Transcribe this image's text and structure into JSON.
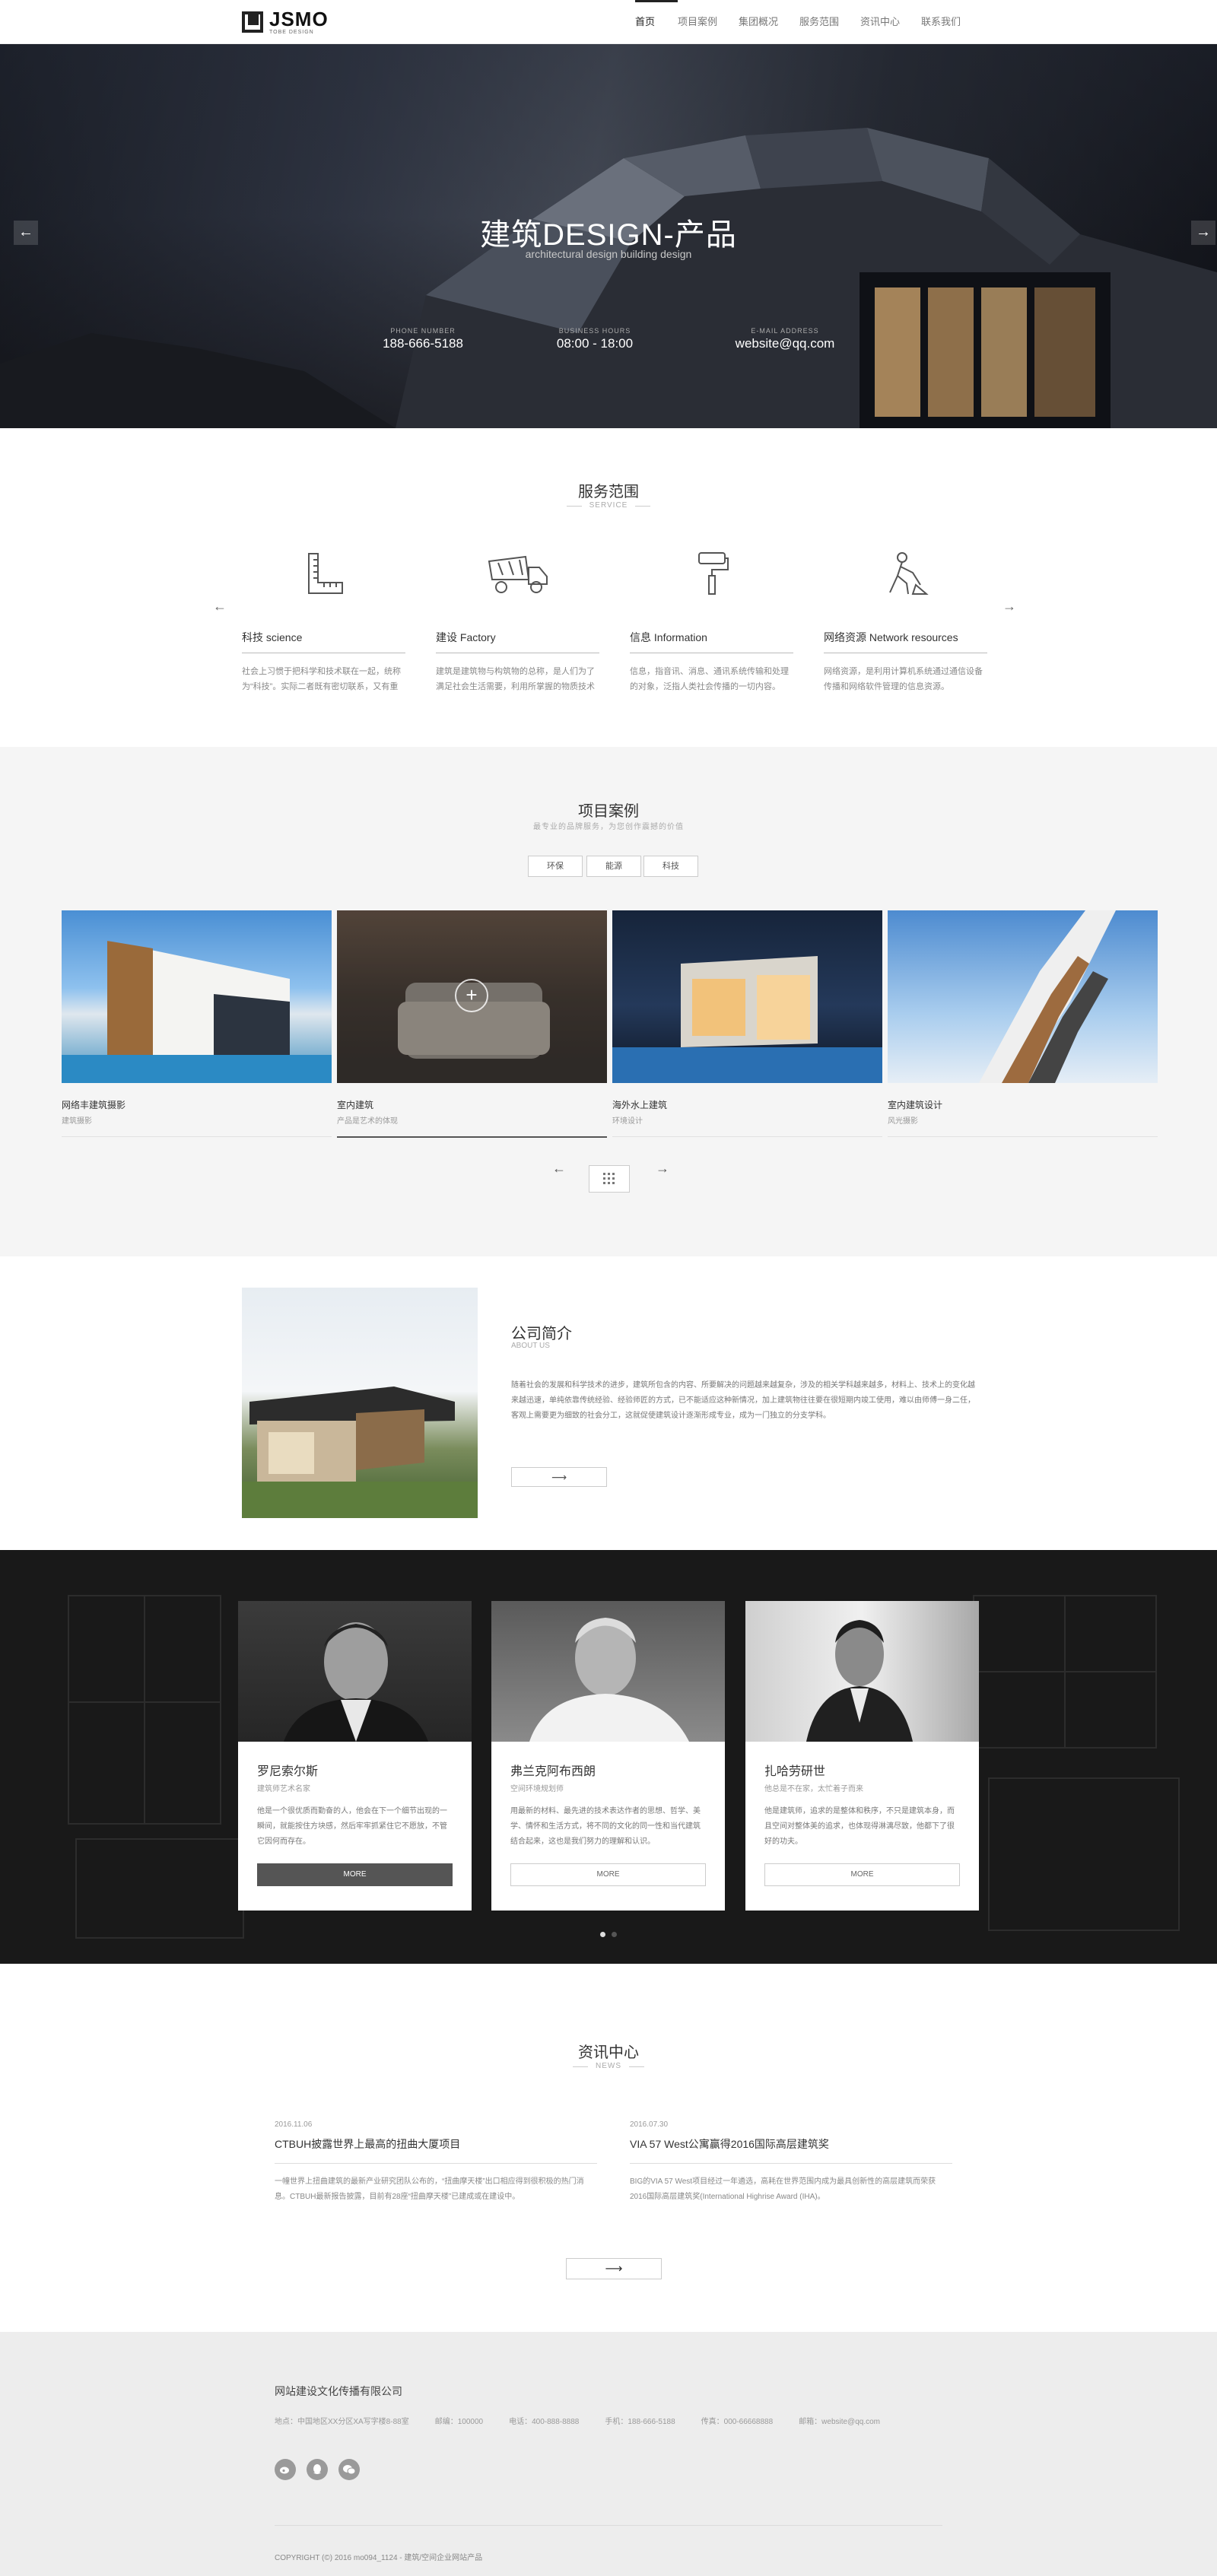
{
  "header": {
    "logo": {
      "name": "JSMO",
      "sub": "TOBE DESIGN"
    },
    "nav": [
      {
        "label": "首页",
        "active": true
      },
      {
        "label": "项目案例",
        "active": false
      },
      {
        "label": "集团概况",
        "active": false
      },
      {
        "label": "服务范围",
        "active": false
      },
      {
        "label": "资讯中心",
        "active": false
      },
      {
        "label": "联系我们",
        "active": false
      }
    ]
  },
  "hero": {
    "title": "建筑DESIGN-产品",
    "subtitle": "architectural design building design",
    "info": [
      {
        "label": "PHONE NUMBER",
        "value": "188-666-5188"
      },
      {
        "label": "BUSINESS HOURS",
        "value": "08:00 - 18:00"
      },
      {
        "label": "E-MAIL ADDRESS",
        "value": "website@qq.com"
      }
    ],
    "prev": "←",
    "next": "→"
  },
  "services": {
    "title": "服务范围",
    "subtitle": "SERVICE",
    "prev": "←",
    "next": "→",
    "items": [
      {
        "icon": "ruler-icon",
        "title": "科技 science",
        "desc": "社会上习惯于把科学和技术联在一起，统称为“科技”。实际二者既有密切联系，又有重要区别。"
      },
      {
        "icon": "dump-truck-icon",
        "title": "建设 Factory",
        "desc": "建筑是建筑物与构筑物的总称，是人们为了满足社会生活需要，利用所掌握的物质技术手段。"
      },
      {
        "icon": "paint-roller-icon",
        "title": "信息 Information",
        "desc": "信息，指音讯、消息、通讯系统传输和处理的对象，泛指人类社会传播的一切内容。"
      },
      {
        "icon": "worker-icon",
        "title": "网络资源 Network resources",
        "desc": "网络资源，是利用计算机系统通过通信设备传播和网络软件管理的信息资源。"
      }
    ]
  },
  "projects": {
    "title": "项目案例",
    "subtitle": "最专业的品牌服务，为您创作震撼的价值",
    "filters": [
      "环保",
      "能源",
      "科技"
    ],
    "items": [
      {
        "title": "网络丰建筑摄影",
        "category": "建筑摄影"
      },
      {
        "title": "室内建筑",
        "category": "产品是艺术的体现"
      },
      {
        "title": "海外水上建筑",
        "category": "环境设计"
      },
      {
        "title": "室内建筑设计",
        "category": "风光摄影"
      }
    ],
    "plus": "+",
    "pager_prev": "←",
    "pager_next": "→"
  },
  "about": {
    "title": "公司简介",
    "subtitle": "ABOUT US",
    "text": "随着社会的发展和科学技术的进步，建筑所包含的内容、所要解决的问题越来越复杂，涉及的相关学科越来越多，材料上、技术上的变化越来越迅速，单纯依靠传统经验、经验师匠的方式，已不能适应这种新情况，加上建筑物往往要在很短期内竣工使用，难以由师傅一身二任，客观上需要更为细致的社会分工，这就促使建筑设计逐渐形成专业，成为一门独立的分支学科。",
    "more": "⟶"
  },
  "team": {
    "members": [
      {
        "name": "罗尼索尔斯",
        "role": "建筑师艺术名家",
        "desc": "他是一个很优质而勤奋的人，他会在下一个细节出现的一瞬间，就能按住方块感，然后牢牢抓紧住它不愿放，不管它因何而存在。",
        "button": "MORE",
        "active": true
      },
      {
        "name": "弗兰克阿布西朗",
        "role": "空间环境规划师",
        "desc": "用最新的材料、最先进的技术表达作者的思想、哲学、美学、情怀和生活方式，将不同的文化的同一性和当代建筑结合起来，这也是我们努力的理解和认识。",
        "button": "MORE",
        "active": false
      },
      {
        "name": "扎哈劳研世",
        "role": "他总是不在家，太忙着子而来",
        "desc": "他是建筑师，追求的是整体和秩序，不只是建筑本身，而且空间对整体美的追求，也体现得淋漓尽致，他都下了很好的功夫。",
        "button": "MORE",
        "active": false
      }
    ]
  },
  "news": {
    "title": "资讯中心",
    "subtitle": "NEWS",
    "items": [
      {
        "date": "2016.11.06",
        "title": "CTBUH披露世界上最高的扭曲大厦项目",
        "desc": "一幢世界上扭曲建筑的最新产业研究团队公布的，“扭曲摩天楼”出口相应得到很积极的热门消息。CTBUH最新报告披露，目前有28座“扭曲摩天楼”已建成或在建设中。"
      },
      {
        "date": "2016.07.30",
        "title": "VIA 57 West公寓赢得2016国际高层建筑奖",
        "desc": "BIG的VIA 57 West项目经过一年遴选，高耗在世界范围内成为最具创新性的高层建筑而荣获2016国际高层建筑奖(International Highrise Award (IHA)。"
      }
    ],
    "more": "⟶"
  },
  "footer": {
    "company": "网站建设文化传播有限公司",
    "contact": [
      "地点：中国地区XX分区XA写字楼8-88室",
      "邮编：100000",
      "电话：400-888-8888",
      "手机：188-666-5188",
      "传真：000-66668888",
      "邮箱：website@qq.com"
    ],
    "social": [
      "weibo-icon",
      "qq-icon",
      "wechat-icon"
    ],
    "copyright": "COPYRIGHT (©) 2016 mo094_1124 - 建筑/空间企业网站产品"
  },
  "colors": {
    "dark": "#191919",
    "accent": "#555555",
    "light_bg": "#f5f5f5",
    "footer_bg": "#ededed"
  }
}
